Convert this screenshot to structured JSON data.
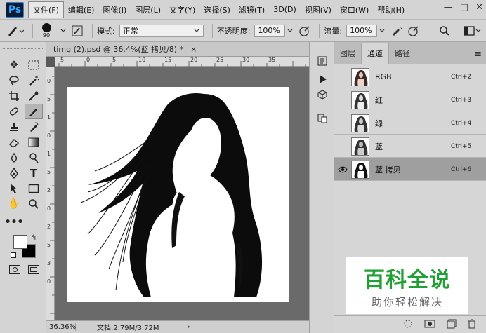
{
  "app": {
    "logo": "Ps"
  },
  "menus": [
    "文件(F)",
    "编辑(E)",
    "图像(I)",
    "图层(L)",
    "文字(Y)",
    "选择(S)",
    "滤镜(T)",
    "3D(D)",
    "视图(V)",
    "窗口(W)",
    "帮助(H)"
  ],
  "window_buttons": [
    "—",
    "□",
    "✕"
  ],
  "options": {
    "brush_size": "90",
    "mode_label": "模式:",
    "mode_value": "正常",
    "opacity_label": "不透明度:",
    "opacity_value": "100%",
    "flow_label": "流量:",
    "flow_value": "100%"
  },
  "document": {
    "tab_title": "timg (2).psd @ 36.4%(蓝 拷贝/8) *",
    "tab_close": "×",
    "zoom": "36.36%",
    "doc_info": "文档:2.79M/3.72M",
    "ruler_h_ticks": [
      "5",
      "0",
      "5",
      "10",
      "15",
      "20",
      "25",
      "30",
      "35"
    ],
    "ruler_v_ticks": [
      "0",
      "5",
      "1",
      "0",
      "1",
      "5",
      "2",
      "0",
      "2",
      "5",
      "3",
      "0",
      "3",
      "5"
    ]
  },
  "panel": {
    "tabs": [
      "图层",
      "通道",
      "路径"
    ],
    "active_tab": 1,
    "channels": [
      {
        "name": "RGB",
        "shortcut": "Ctrl+2",
        "visible": false
      },
      {
        "name": "红",
        "shortcut": "Ctrl+3",
        "visible": false
      },
      {
        "name": "绿",
        "shortcut": "Ctrl+4",
        "visible": false
      },
      {
        "name": "蓝",
        "shortcut": "Ctrl+5",
        "visible": false
      },
      {
        "name": "蓝 拷贝",
        "shortcut": "Ctrl+6",
        "visible": true
      }
    ]
  },
  "watermark": {
    "title": "百科全说",
    "subtitle": "助你轻松解决"
  },
  "colors": {
    "accent": "#31a8ff",
    "watermark_green": "#1f9f34",
    "canvas_gray": "#6a6a6a"
  }
}
